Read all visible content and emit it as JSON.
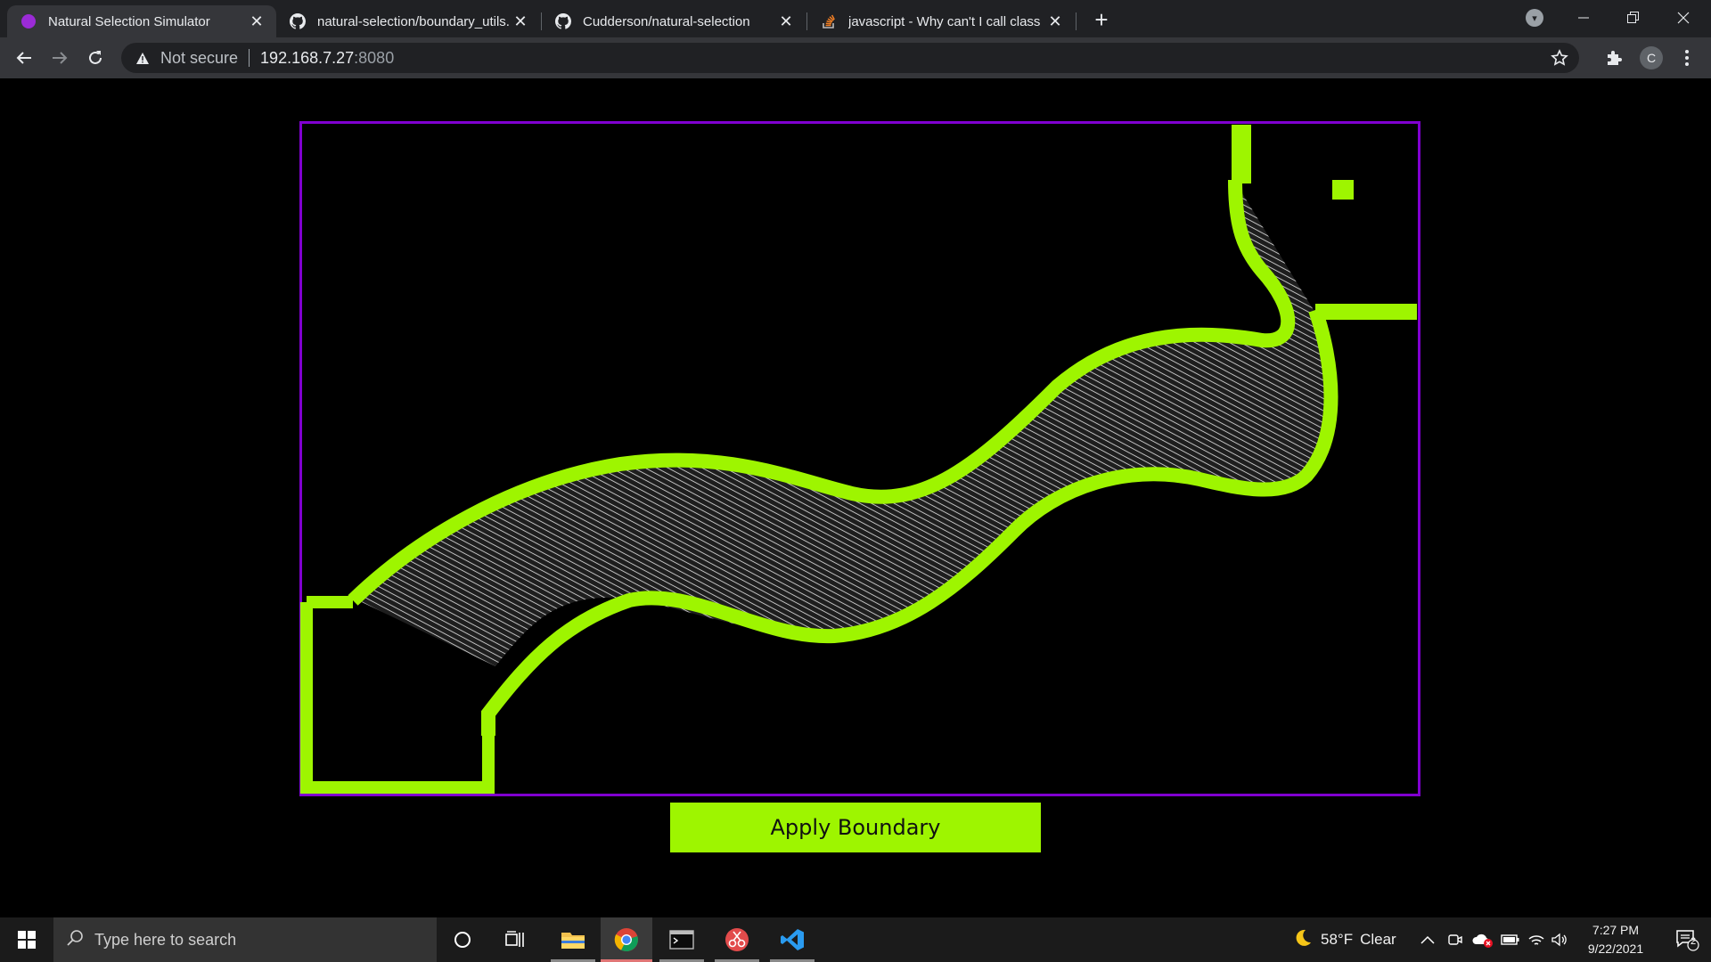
{
  "browser": {
    "tabs": [
      {
        "title": "Natural Selection Simulator",
        "favicon": "purple-circle-icon",
        "active": true
      },
      {
        "title": "natural-selection/boundary_utils.",
        "favicon": "github-icon",
        "active": false
      },
      {
        "title": "Cudderson/natural-selection",
        "favicon": "github-icon",
        "active": false
      },
      {
        "title": "javascript - Why can't I call class",
        "favicon": "stackoverflow-icon",
        "active": false
      }
    ],
    "new_tab_label": "+",
    "address": {
      "security_label": "Not secure",
      "host": "192.168.7.27",
      "port": ":8080"
    },
    "profile_initial": "C"
  },
  "page": {
    "canvas_border_color": "#8000d0",
    "boundary_color": "#9ef500",
    "apply_button_label": "Apply Boundary"
  },
  "taskbar": {
    "search_placeholder": "Type here to search",
    "weather": {
      "temp": "58°F",
      "condition": "Clear",
      "icon": "moon-icon"
    },
    "time": "7:27 PM",
    "date": "9/22/2021",
    "notification_count": "2"
  }
}
